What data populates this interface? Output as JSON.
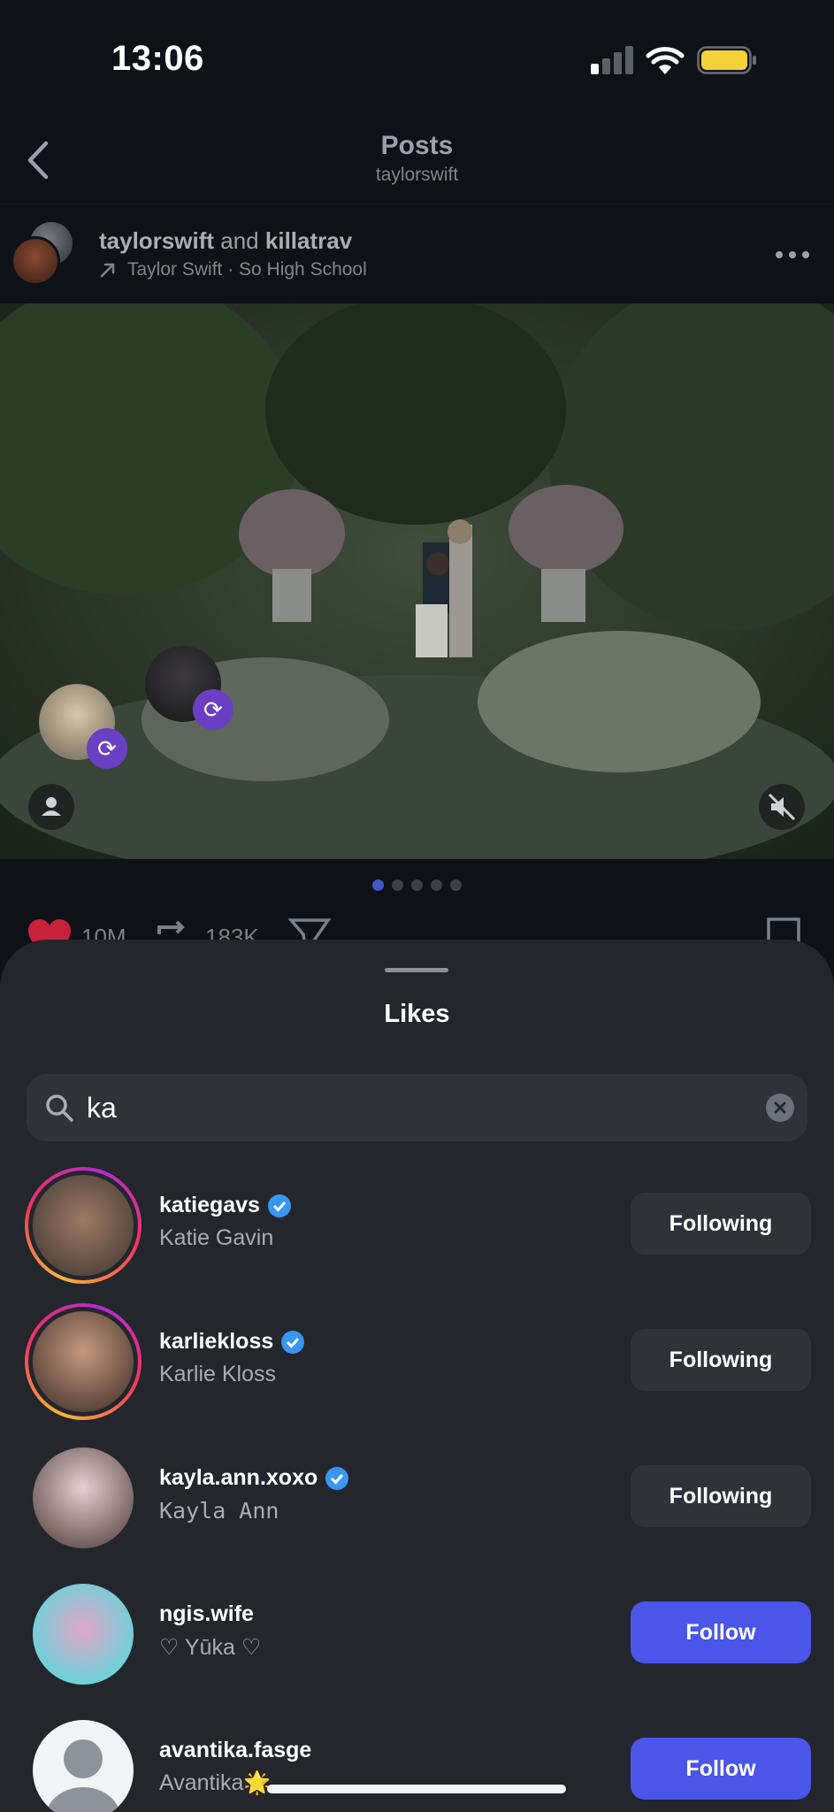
{
  "status": {
    "time": "13:06"
  },
  "header": {
    "title": "Posts",
    "subtitle": "taylorswift"
  },
  "post": {
    "author": "taylorswift",
    "joiner": "and",
    "coauthor": "killatrav",
    "song": "Taylor Swift · So High School",
    "like_count": "10M",
    "repost_count": "183K",
    "carousel_total": 5,
    "carousel_index": 1
  },
  "sheet": {
    "title": "Likes",
    "search": {
      "value": "ka",
      "placeholder": "Search"
    },
    "users": [
      {
        "username": "katiegavs",
        "name": "Katie Gavin",
        "verified": true,
        "story_ring": true,
        "button": "Following"
      },
      {
        "username": "karliekloss",
        "name": "Karlie Kloss",
        "verified": true,
        "story_ring": true,
        "button": "Following"
      },
      {
        "username": "kayla.ann.xoxo",
        "name": "Kayla Ann",
        "verified": true,
        "story_ring": false,
        "button": "Following"
      },
      {
        "username": "ngis.wife",
        "name": "♡ Yūka ♡",
        "verified": false,
        "story_ring": false,
        "button": "Follow"
      },
      {
        "username": "avantika.fasge",
        "name": "Avantika🌟",
        "verified": false,
        "story_ring": false,
        "button": "Follow"
      }
    ]
  },
  "colors": {
    "accent": "#4a55ea",
    "verified": "#3897f0",
    "like": "#e0243b",
    "sheet_bg": "#24262d"
  }
}
